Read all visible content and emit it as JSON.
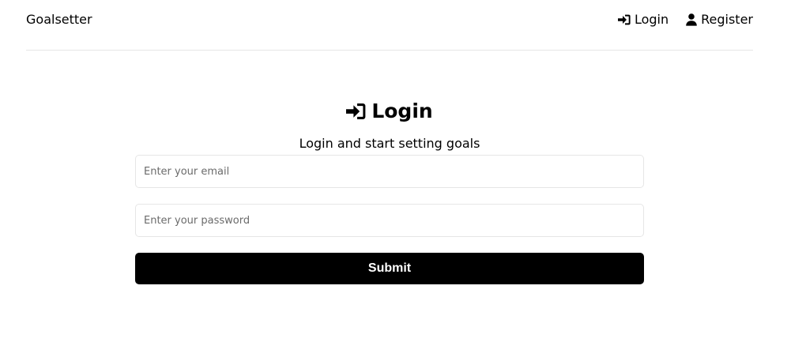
{
  "header": {
    "logo_text": "Goalsetter",
    "nav": {
      "login": {
        "label": "Login",
        "icon": "sign-in-icon"
      },
      "register": {
        "label": "Register",
        "icon": "user-icon"
      }
    }
  },
  "heading": {
    "title": "Login",
    "icon": "sign-in-icon",
    "subtitle": "Login and start setting goals"
  },
  "form": {
    "email": {
      "placeholder": "Enter your email",
      "value": ""
    },
    "password": {
      "placeholder": "Enter your password",
      "value": ""
    },
    "submit_label": "Submit"
  },
  "colors": {
    "button_bg": "#000000",
    "button_text": "#ffffff",
    "border": "#e6e6e6",
    "placeholder": "#6b6b6b"
  }
}
